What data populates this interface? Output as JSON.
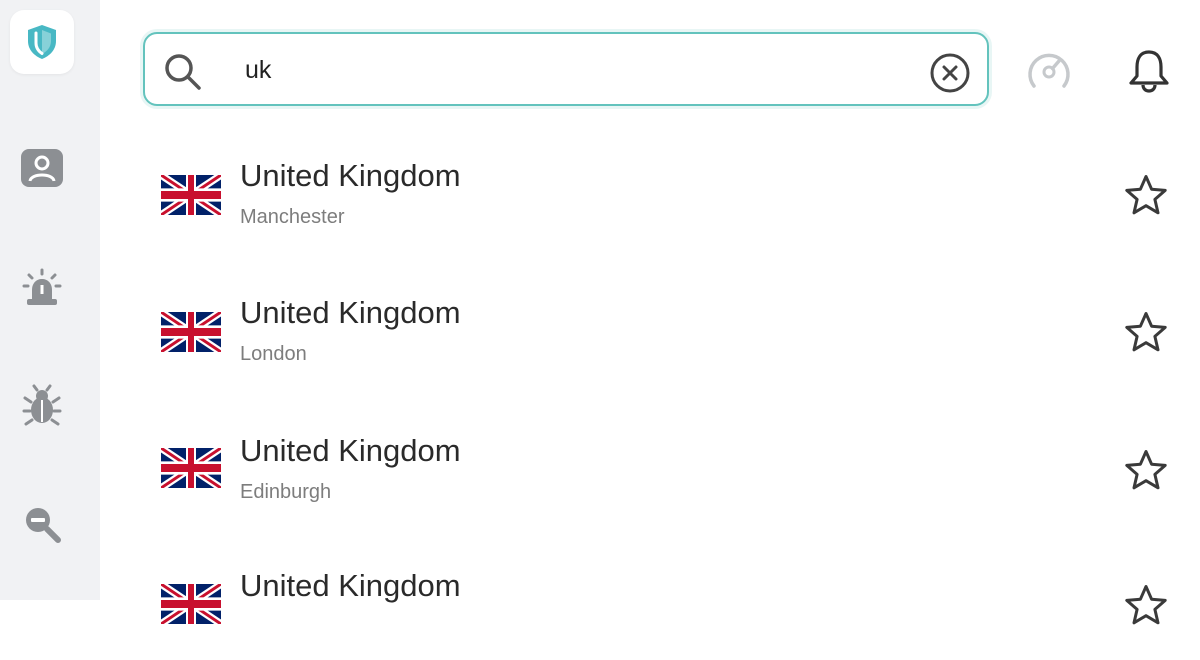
{
  "search": {
    "value": "uk",
    "accent_color": "#63c3bd"
  },
  "sidebar": {
    "items": [
      {
        "icon": "shield-icon",
        "active": true
      },
      {
        "icon": "profile-icon",
        "active": false
      },
      {
        "icon": "alert-light-icon",
        "active": false
      },
      {
        "icon": "bug-icon",
        "active": false
      },
      {
        "icon": "magnifier-icon",
        "active": false
      }
    ]
  },
  "toolbar": {
    "icons": [
      "speed-gauge-icon",
      "bell-icon"
    ]
  },
  "results": [
    {
      "country": "United Kingdom",
      "city": "Manchester",
      "flag": "uk-flag-icon",
      "favorite": false
    },
    {
      "country": "United Kingdom",
      "city": "London",
      "flag": "uk-flag-icon",
      "favorite": false
    },
    {
      "country": "United Kingdom",
      "city": "Edinburgh",
      "flag": "uk-flag-icon",
      "favorite": false
    },
    {
      "country": "United Kingdom",
      "city": "",
      "flag": "uk-flag-icon",
      "favorite": false
    }
  ]
}
